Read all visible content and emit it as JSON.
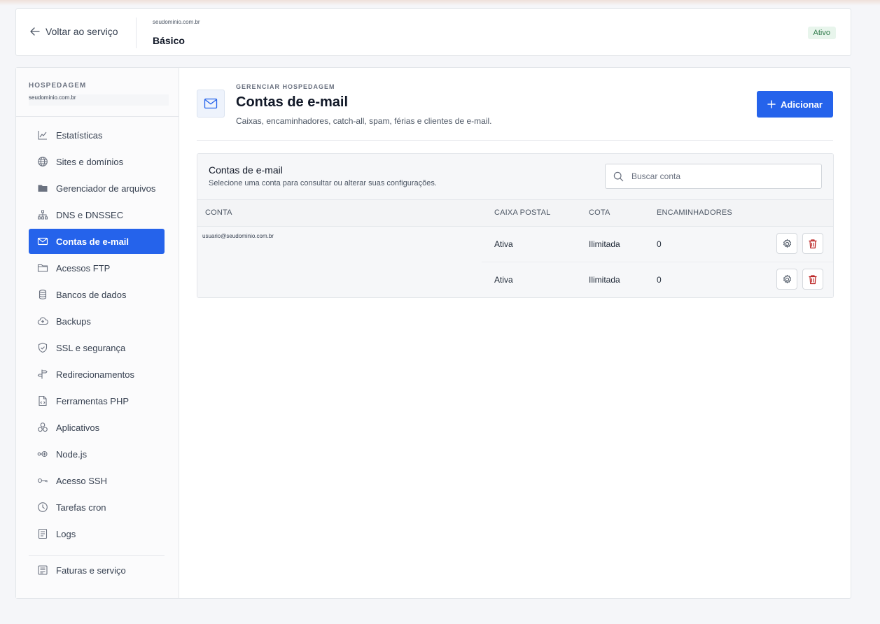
{
  "header": {
    "back_label": "Voltar ao serviço",
    "domain": "seudominio.com.br",
    "plan": "Básico",
    "status": "Ativo"
  },
  "sidebar": {
    "section_label": "HOSPEDAGEM",
    "domain": "seudominio.com.br",
    "items": [
      {
        "label": "Estatísticas",
        "icon": "chart-line-icon"
      },
      {
        "label": "Sites e domínios",
        "icon": "globe-icon"
      },
      {
        "label": "Gerenciador de arquivos",
        "icon": "folder-icon"
      },
      {
        "label": "DNS e DNSSEC",
        "icon": "network-icon"
      },
      {
        "label": "Contas de e-mail",
        "icon": "mail-icon",
        "active": true
      },
      {
        "label": "Acessos FTP",
        "icon": "folder-outline-icon"
      },
      {
        "label": "Bancos de dados",
        "icon": "database-icon"
      },
      {
        "label": "Backups",
        "icon": "cloud-upload-icon"
      },
      {
        "label": "SSL e segurança",
        "icon": "shield-icon"
      },
      {
        "label": "Redirecionamentos",
        "icon": "signpost-icon"
      },
      {
        "label": "Ferramentas PHP",
        "icon": "file-code-icon"
      },
      {
        "label": "Aplicativos",
        "icon": "apps-icon"
      },
      {
        "label": "Node.js",
        "icon": "node-icon"
      },
      {
        "label": "Acesso SSH",
        "icon": "key-icon"
      },
      {
        "label": "Tarefas cron",
        "icon": "clock-icon"
      },
      {
        "label": "Logs",
        "icon": "log-icon"
      }
    ],
    "bottom_item": {
      "label": "Faturas e serviço",
      "icon": "invoice-icon"
    }
  },
  "page": {
    "eyebrow": "GERENCIAR HOSPEDAGEM",
    "title": "Contas de e-mail",
    "subtitle": "Caixas, encaminhadores, catch-all, spam, férias e clientes de e-mail.",
    "add_label": "Adicionar"
  },
  "table": {
    "title": "Contas de e-mail",
    "subtitle": "Selecione uma conta para consultar ou alterar suas configurações.",
    "search_placeholder": "Buscar conta",
    "columns": [
      "CONTA",
      "CAIXA POSTAL",
      "COTA",
      "ENCAMINHADORES"
    ],
    "account": "usuario@seudominio.com.br",
    "rows": [
      {
        "mailbox": "Ativa",
        "quota": "Ilimitada",
        "forwarders": "0"
      },
      {
        "mailbox": "Ativa",
        "quota": "Ilimitada",
        "forwarders": "0"
      }
    ]
  },
  "colors": {
    "accent": "#2563eb",
    "status_bg": "#e8f5ec",
    "status_text": "#2f7a4a",
    "delete": "#b91c1c"
  }
}
